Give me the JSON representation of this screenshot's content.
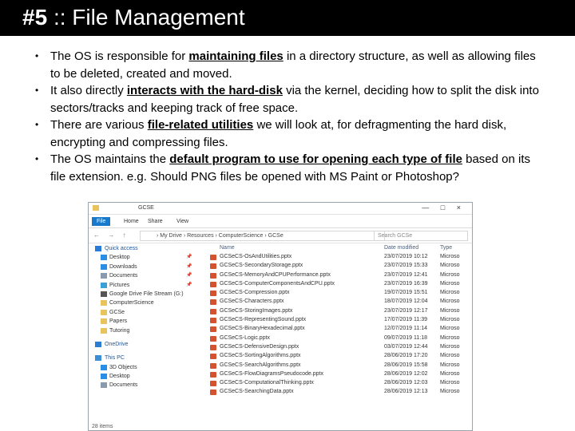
{
  "slide": {
    "title_number": "#5",
    "title_sep": "::",
    "title_text": "File Management",
    "bullets": [
      {
        "before": "The OS is responsible for ",
        "highlight": "maintaining files",
        "after": " in a directory structure, as well as allowing files to be deleted, created and moved."
      },
      {
        "before": "It also directly ",
        "highlight": "interacts with the hard-disk",
        "after": " via the kernel, deciding how to split the disk into sectors/tracks and keeping track of free space."
      },
      {
        "before": "There are various ",
        "highlight": "file-related utilities",
        "after": " we will look at, for defragmenting the hard disk, encrypting and compressing files."
      },
      {
        "before": "The OS maintains the ",
        "highlight": "default program to use for opening each type of file",
        "after": " based on its file extension. e.g. Should PNG files be opened with MS Paint or Photoshop?"
      }
    ]
  },
  "explorer": {
    "window_title": "GCSE",
    "window_controls": "— □ ×",
    "ribbon_tabs": [
      "File",
      "Home",
      "Share",
      "View"
    ],
    "nav_buttons": "← → ↑",
    "address_path": "› My Drive › Resources › ComputerScience › GCSe",
    "search_placeholder": "Search GCSe",
    "nav_items": [
      {
        "label": "Quick access",
        "icon": "star-icon",
        "color": "#2a7ad8",
        "top": true
      },
      {
        "label": "Desktop",
        "icon": "desktop-icon",
        "color": "#2b8ee6",
        "pinned": true
      },
      {
        "label": "Downloads",
        "icon": "download-icon",
        "color": "#2b8ee6",
        "pinned": true
      },
      {
        "label": "Documents",
        "icon": "documents-icon",
        "color": "#8a9bb0",
        "pinned": true
      },
      {
        "label": "Pictures",
        "icon": "pictures-icon",
        "color": "#3aa0d8",
        "pinned": true
      },
      {
        "label": "Google Drive File Stream (G:)",
        "icon": "drive-icon",
        "color": "#555555"
      },
      {
        "label": "ComputerScience",
        "icon": "folder-icon",
        "color": "#e9c35c"
      },
      {
        "label": "GCSe",
        "icon": "folder-icon",
        "color": "#e9c35c"
      },
      {
        "label": "Papers",
        "icon": "folder-icon",
        "color": "#e9c35c"
      },
      {
        "label": "Tutoring",
        "icon": "folder-icon",
        "color": "#e9c35c"
      },
      {
        "label": "OneDrive",
        "icon": "cloud-icon",
        "color": "#2b7cd3",
        "top": true,
        "gap": true
      },
      {
        "label": "This PC",
        "icon": "computer-icon",
        "color": "#3a8fd8",
        "top": true,
        "gap": true
      },
      {
        "label": "3D Objects",
        "icon": "cube-icon",
        "color": "#2b8ee6"
      },
      {
        "label": "Desktop",
        "icon": "desktop-icon",
        "color": "#2b8ee6"
      },
      {
        "label": "Documents",
        "icon": "documents-icon",
        "color": "#8a9bb0"
      }
    ],
    "columns": [
      "Name",
      "Date modified",
      "Type"
    ],
    "files": [
      {
        "name": "GCSeCS-OsAndUtilities.pptx",
        "date": "23/07/2019 10:12",
        "type": "Microso"
      },
      {
        "name": "GCSeCS-SecondaryStorage.pptx",
        "date": "23/07/2019 15:33",
        "type": "Microso"
      },
      {
        "name": "GCSeCS-MemoryAndCPUPerformance.pptx",
        "date": "23/07/2019 12:41",
        "type": "Microso"
      },
      {
        "name": "GCSeCS-ComputerComponentsAndCPU.pptx",
        "date": "23/07/2019 16:39",
        "type": "Microso"
      },
      {
        "name": "GCSeCS-Compression.pptx",
        "date": "19/07/2019 15:51",
        "type": "Microso"
      },
      {
        "name": "GCSeCS-Characters.pptx",
        "date": "18/07/2019 12:04",
        "type": "Microso"
      },
      {
        "name": "GCSeCS-StoringImages.pptx",
        "date": "23/07/2019 12:17",
        "type": "Microso"
      },
      {
        "name": "GCSeCS-RepresentingSound.pptx",
        "date": "17/07/2019 11:39",
        "type": "Microso"
      },
      {
        "name": "GCSeCS-BinaryHexadecimal.pptx",
        "date": "12/07/2019 11:14",
        "type": "Microso"
      },
      {
        "name": "GCSeCS-Logic.pptx",
        "date": "09/07/2019 11:18",
        "type": "Microso"
      },
      {
        "name": "GCSeCS-DefensiveDesign.pptx",
        "date": "03/07/2019 12:44",
        "type": "Microso"
      },
      {
        "name": "GCSeCS-SortingAlgorithms.pptx",
        "date": "28/06/2019 17:20",
        "type": "Microso"
      },
      {
        "name": "GCSeCS-SearchAlgorithms.pptx",
        "date": "28/06/2019 15:58",
        "type": "Microso"
      },
      {
        "name": "GCSeCS-FlowDiagramsPseudocode.pptx",
        "date": "28/06/2019 12:02",
        "type": "Microso"
      },
      {
        "name": "GCSeCS-ComputationalThinking.pptx",
        "date": "28/06/2019 12:03",
        "type": "Microso"
      },
      {
        "name": "GCSeCS-SearchingData.pptx",
        "date": "28/06/2019 12:13",
        "type": "Microso"
      }
    ],
    "status": "28 items"
  }
}
